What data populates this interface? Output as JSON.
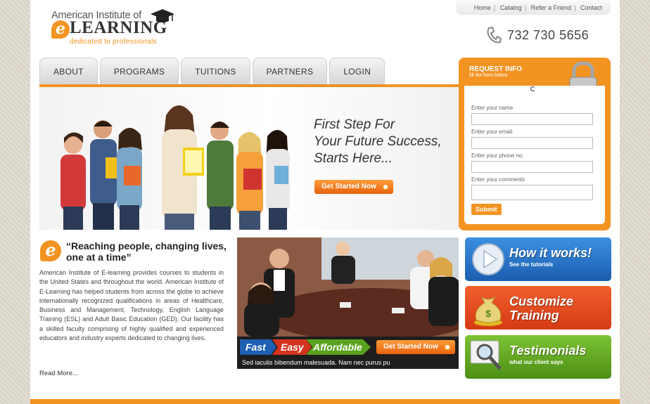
{
  "logo": {
    "top_text": "American Institute of",
    "letter": "e",
    "big_text": "LEARNING",
    "tagline": "dedicated to professionals"
  },
  "top_links": [
    "Home",
    "Catalog",
    "Refer a Friend",
    "Contact"
  ],
  "phone": "732 730 5656",
  "nav": [
    "ABOUT",
    "PROGRAMS",
    "TUITIONS",
    "PARTNERS",
    "LOGIN"
  ],
  "hero": {
    "headline": [
      "First Step For",
      "Your Future Success,",
      "Starts Here..."
    ],
    "cta": "Get Started Now"
  },
  "request": {
    "title": "REQUEST INFO",
    "subtitle": "fill the form below",
    "fields": [
      "Enter your name",
      "Enter your email",
      "Enter your phone no.",
      "Enter your comments"
    ],
    "submit": "Submit"
  },
  "intro": {
    "letter": "e",
    "quote": "“Reaching people, changing lives, one at a time”",
    "body": "American Institute of E-learning provides courses to students in the United States and throughout the world. American Institute of E-Learning has helped students from across the globe to achieve internationally recognized qualifications in areas of Healthcare, Business and Management, Technology, English Language Training (ESL) and Adult Basic Education (GED). Our facility has a skilled faculty comprising of highly qualified and experienced educators and industry experts dedicated to changing lives.",
    "read_more": "Read More..."
  },
  "promo": {
    "words": [
      "Fast",
      "Easy",
      "Affordable"
    ],
    "cta": "Get Started Now",
    "caption": "Sed iaculis bibendum malesuada. Nam nec purus pu"
  },
  "boxes": [
    {
      "title": "How it works!",
      "subtitle": "See the tutorials",
      "color": "#1f6fc4"
    },
    {
      "title": "Customize Training",
      "subtitle": "",
      "color": "#e4421a"
    },
    {
      "title": "Testimonials",
      "subtitle": "what our client says",
      "color": "#5aa21d"
    }
  ],
  "colors": {
    "accent": "#f29322"
  }
}
